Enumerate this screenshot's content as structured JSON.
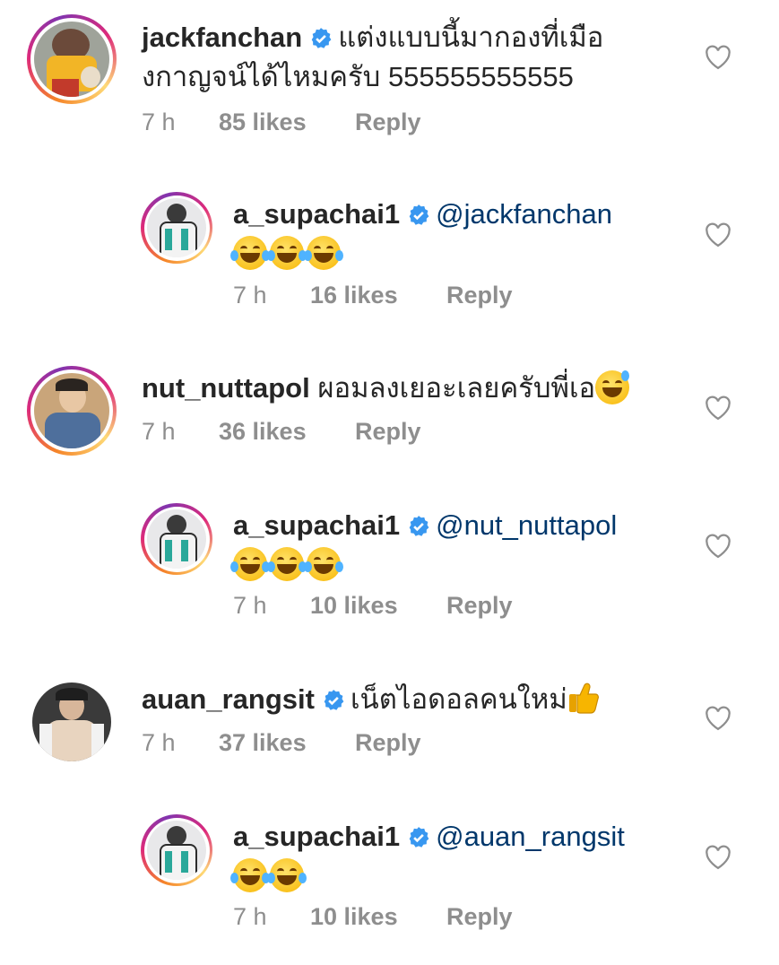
{
  "comments": [
    {
      "username": "jackfanchan",
      "verified": true,
      "text_line1": "แต่งแบบนี้มากองที่เมือ",
      "text_line2": "งกาญจน์ได้ไหมครับ 555555555555",
      "time": "7 h",
      "likes": "85 likes",
      "reply": "Reply"
    },
    {
      "username": "a_supachai1",
      "verified": true,
      "mention": "@jackfanchan",
      "emoji": [
        "face-with-tears-of-joy",
        "face-with-tears-of-joy",
        "face-with-tears-of-joy"
      ],
      "time": "7 h",
      "likes": "16 likes",
      "reply": "Reply"
    },
    {
      "username": "nut_nuttapol",
      "verified": false,
      "text_line1": "ผอมลงเยอะเลยครับพี่เอ",
      "emoji": [
        "grinning-face-with-sweat"
      ],
      "time": "7 h",
      "likes": "36 likes",
      "reply": "Reply"
    },
    {
      "username": "a_supachai1",
      "verified": true,
      "mention": "@nut_nuttapol",
      "emoji": [
        "face-with-tears-of-joy",
        "face-with-tears-of-joy",
        "face-with-tears-of-joy"
      ],
      "time": "7 h",
      "likes": "10 likes",
      "reply": "Reply"
    },
    {
      "username": "auan_rangsit",
      "verified": true,
      "text_line1": "เน็ตไอดอลคนใหม่",
      "emoji": [
        "thumbs-up"
      ],
      "time": "7 h",
      "likes": "37 likes",
      "reply": "Reply"
    },
    {
      "username": "a_supachai1",
      "verified": true,
      "mention": "@auan_rangsit",
      "emoji": [
        "face-with-tears-of-joy",
        "face-with-tears-of-joy"
      ],
      "time": "7 h",
      "likes": "10 likes",
      "reply": "Reply"
    }
  ],
  "colors": {
    "mention": "#00376b",
    "verified": "#3897f0",
    "meta": "#8e8e8e"
  }
}
